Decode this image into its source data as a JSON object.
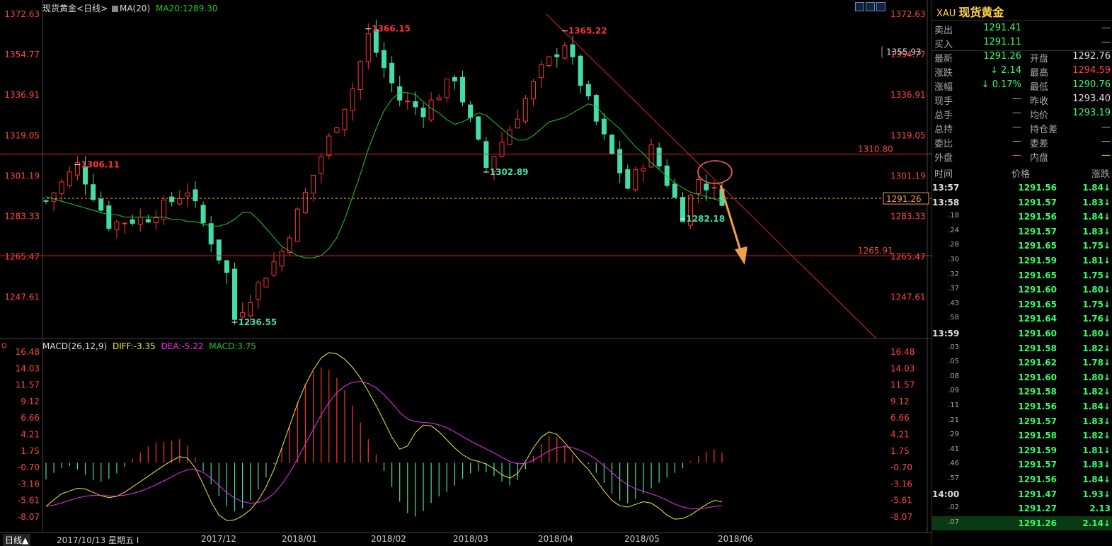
{
  "header": {
    "instrument": "现货黄金",
    "period": "<日线>",
    "ma_label": "MA(20)",
    "ma_value": "MA20:1289.30"
  },
  "macd_header": {
    "label": "MACD(26,12,9)",
    "diff": "DIFF:-3.35",
    "dea": "DEA:-5.22",
    "macd": "MACD:3.75"
  },
  "footer": {
    "period_button": "日线▲",
    "date_label": "2017/10/13 星期五 I",
    "x_ticks": [
      "2017/12",
      "2018/01",
      "2018/02",
      "2018/03",
      "2018/04",
      "2018/05",
      "2018/06"
    ]
  },
  "colors": {
    "up": "#ff3333",
    "down": "#44ddaa",
    "ma": "#22cc22",
    "diff": "#eeee33",
    "dea": "#ee33ee",
    "trendline": "#dd2222",
    "arrow": "#f0a048",
    "gain_text": "#33ff66"
  },
  "chart_data": [
    {
      "type": "candlestick",
      "title": "",
      "y_ticks": [
        "1372.63",
        "1354.77",
        "1336.91",
        "1319.05",
        "1301.19",
        "1283.33",
        "1265.47",
        "1247.61"
      ],
      "ylim": [
        1236.55,
        1372.63
      ],
      "annotations": [
        {
          "label": "1306.11",
          "x": "2017/10",
          "y": 1306.11,
          "color": "#ff3333"
        },
        {
          "label": "1366.15",
          "x": "2018/01",
          "y": 1366.15,
          "color": "#ff3333"
        },
        {
          "label": "1365.22",
          "x": "2018/04",
          "y": 1365.22,
          "color": "#ff3333"
        },
        {
          "label": "1302.89",
          "x": "2018/03",
          "y": 1302.89,
          "color": "#44ddaa"
        },
        {
          "label": "1282.18",
          "x": "2018/05",
          "y": 1282.18,
          "color": "#44ddaa"
        },
        {
          "label": "1236.55",
          "x": "2017/12",
          "y": 1236.55,
          "color": "#44ddaa"
        }
      ],
      "horizontal_lines": [
        {
          "value": 1310.8,
          "label": "1310.80"
        },
        {
          "value": 1265.91,
          "label": "1265.91"
        }
      ],
      "current_price": {
        "value": 1291.26,
        "label": "1291.26"
      },
      "tag_label": "1355.93",
      "series": [
        {
          "name": "MA20",
          "values": [
            1292,
            1291,
            1290,
            1289,
            1288,
            1287,
            1286,
            1285,
            1284,
            1284,
            1283,
            1283,
            1283,
            1283,
            1283,
            1283,
            1282,
            1282,
            1281,
            1281,
            1280,
            1279,
            1279,
            1280,
            1282,
            1285,
            1285,
            1282,
            1278,
            1274,
            1270,
            1268,
            1266,
            1265,
            1265,
            1266,
            1269,
            1274,
            1282,
            1292,
            1302,
            1313,
            1322,
            1330,
            1335,
            1338,
            1338,
            1337,
            1334,
            1331,
            1329,
            1326,
            1324,
            1325,
            1327,
            1329,
            1328,
            1325,
            1322,
            1319,
            1317,
            1317,
            1319,
            1322,
            1325,
            1326,
            1327,
            1329,
            1331,
            1333,
            1332,
            1328,
            1325,
            1322,
            1318,
            1314,
            1311,
            1307,
            1304,
            1301,
            1298,
            1296,
            1294,
            1293,
            1292,
            1291,
            1290
          ]
        }
      ]
    },
    {
      "type": "bar",
      "title": "",
      "y_ticks": [
        "16.48",
        "14.03",
        "11.57",
        "9.12",
        "6.66",
        "4.21",
        "1.75",
        "-0.70",
        "-3.16",
        "-5.61",
        "-8.07"
      ],
      "ylim": [
        -8.07,
        16.48
      ],
      "macd_values": [
        -2.5,
        -1.5,
        -0.8,
        -0.5,
        -1.0,
        -1.8,
        -2.6,
        -2.8,
        -2.4,
        -1.6,
        -0.6,
        0.6,
        1.5,
        2.4,
        3.0,
        3.1,
        3.3,
        3.5,
        2.5,
        0.8,
        -1.2,
        -3.2,
        -5.0,
        -6.5,
        -7.2,
        -6.8,
        -5.6,
        -4.0,
        -2.2,
        -0.2,
        2.2,
        5.5,
        9.0,
        11.8,
        13.5,
        14.2,
        13.8,
        12.6,
        10.8,
        8.5,
        6.0,
        3.5,
        1.2,
        -1.2,
        -3.6,
        -5.8,
        -7.5,
        -8.0,
        -7.2,
        -6.0,
        -5.0,
        -4.4,
        -3.4,
        -2.4,
        -1.6,
        -1.2,
        -1.4,
        -2.0,
        -2.8,
        -3.4,
        -2.6,
        -1.0,
        1.0,
        2.8,
        4.0,
        3.8,
        2.6,
        1.2,
        0.3,
        -0.2,
        -1.5,
        -3.0,
        -4.6,
        -5.6,
        -6.0,
        -5.4,
        -4.6,
        -3.8,
        -3.0,
        -2.2,
        -1.5,
        -0.8,
        0.2,
        1.0,
        1.6,
        2.0,
        1.5
      ],
      "diff_values": [
        -6.5,
        -5.5,
        -4.6,
        -4.2,
        -3.8,
        -3.9,
        -4.4,
        -4.9,
        -5.2,
        -5.0,
        -4.4,
        -3.6,
        -2.8,
        -2.0,
        -1.2,
        -0.4,
        0.3,
        0.9,
        0.7,
        -0.8,
        -3.2,
        -5.8,
        -7.8,
        -8.6,
        -8.5,
        -7.9,
        -7.0,
        -5.6,
        -3.6,
        -1.0,
        2.2,
        5.5,
        8.8,
        11.6,
        13.8,
        15.6,
        16.4,
        16.2,
        15.4,
        14.2,
        12.6,
        10.6,
        8.5,
        6.2,
        3.8,
        2.0,
        2.5,
        4.5,
        5.6,
        5.5,
        4.6,
        3.4,
        2.2,
        1.2,
        0.5,
        0.2,
        -0.2,
        -0.9,
        -1.8,
        -2.3,
        -1.6,
        0.2,
        2.2,
        3.8,
        4.6,
        4.2,
        3.0,
        1.6,
        0.2,
        -1.0,
        -2.6,
        -4.2,
        -5.6,
        -6.4,
        -6.6,
        -6.2,
        -5.8,
        -6.0,
        -6.8,
        -7.8,
        -8.4,
        -8.3,
        -7.8,
        -7.0,
        -6.2,
        -5.6,
        -5.8
      ]
    }
  ],
  "quote_panel": {
    "code": "XAU",
    "name": "现货黄金",
    "rows_top": [
      {
        "label": "卖出",
        "value": "1291.41",
        "label2": "",
        "value2": "—"
      },
      {
        "label": "买入",
        "value": "1291.11",
        "label2": "",
        "value2": "—"
      }
    ],
    "rows": [
      {
        "label": "最新",
        "value": "1291.26",
        "label2": "开盘",
        "value2": "1292.76",
        "vcolor": "#33ff66",
        "v2color": "#ddd"
      },
      {
        "label": "涨跌",
        "value": "↓ 2.14",
        "label2": "最高",
        "value2": "1294.59",
        "vcolor": "#33ff66",
        "v2color": "#ff4444"
      },
      {
        "label": "涨幅",
        "value": "↓ 0.17%",
        "label2": "最低",
        "value2": "1290.76",
        "vcolor": "#33ff66",
        "v2color": "#33ff66"
      },
      {
        "label": "现手",
        "value": "—",
        "label2": "昨收",
        "value2": "1293.40",
        "vcolor": "#aaa",
        "v2color": "#ddd"
      },
      {
        "label": "总手",
        "value": "—",
        "label2": "均价",
        "value2": "1293.19",
        "vcolor": "#aaa",
        "v2color": "#33ff66"
      },
      {
        "label": "总持",
        "value": "—",
        "label2": "持仓差",
        "value2": "—",
        "vcolor": "#aaa",
        "v2color": "#aaa"
      },
      {
        "label": "委比",
        "value": "—",
        "label2": "委差",
        "value2": "—",
        "vcolor": "#aaa",
        "v2color": "#aaa"
      },
      {
        "label": "外盘",
        "value": "—",
        "label2": "内盘",
        "value2": "—",
        "vcolor": "#ff4444",
        "v2color": "#33ff66"
      }
    ],
    "table_header": {
      "time": "时间",
      "price": "价格",
      "change": "涨跌"
    },
    "ticks": [
      {
        "t": "13:57",
        "p": "1291.56",
        "c": "1.84↓",
        "big": true
      },
      {
        "t": "13:58",
        "p": "1291.57",
        "c": "1.83↓",
        "big": true
      },
      {
        "t": ".18",
        "p": "1291.56",
        "c": "1.84↓"
      },
      {
        "t": ".24",
        "p": "1291.57",
        "c": "1.83↓"
      },
      {
        "t": ".28",
        "p": "1291.65",
        "c": "1.75↓"
      },
      {
        "t": ".30",
        "p": "1291.59",
        "c": "1.81↓"
      },
      {
        "t": ".32",
        "p": "1291.65",
        "c": "1.75↓"
      },
      {
        "t": ".37",
        "p": "1291.60",
        "c": "1.80↓"
      },
      {
        "t": ".43",
        "p": "1291.65",
        "c": "1.75↓"
      },
      {
        "t": ".58",
        "p": "1291.64",
        "c": "1.76↓"
      },
      {
        "t": "13:59",
        "p": "1291.60",
        "c": "1.80↓",
        "big": true
      },
      {
        "t": ".03",
        "p": "1291.58",
        "c": "1.82↓"
      },
      {
        "t": ".05",
        "p": "1291.62",
        "c": "1.78↓"
      },
      {
        "t": ".08",
        "p": "1291.60",
        "c": "1.80↓"
      },
      {
        "t": ".09",
        "p": "1291.58",
        "c": "1.82↓"
      },
      {
        "t": ".11",
        "p": "1291.56",
        "c": "1.84↓"
      },
      {
        "t": ".21",
        "p": "1291.57",
        "c": "1.83↓"
      },
      {
        "t": ".29",
        "p": "1291.58",
        "c": "1.82↓"
      },
      {
        "t": ".41",
        "p": "1291.59",
        "c": "1.81↓"
      },
      {
        "t": ".46",
        "p": "1291.57",
        "c": "1.83↓"
      },
      {
        "t": ".57",
        "p": "1291.56",
        "c": "1.84↓"
      },
      {
        "t": "14:00",
        "p": "1291.47",
        "c": "1.93↓",
        "big": true
      },
      {
        "t": ".02",
        "p": "1291.27",
        "c": "2.13"
      },
      {
        "t": ".07",
        "p": "1291.26",
        "c": "2.14↓",
        "last": true
      }
    ]
  }
}
